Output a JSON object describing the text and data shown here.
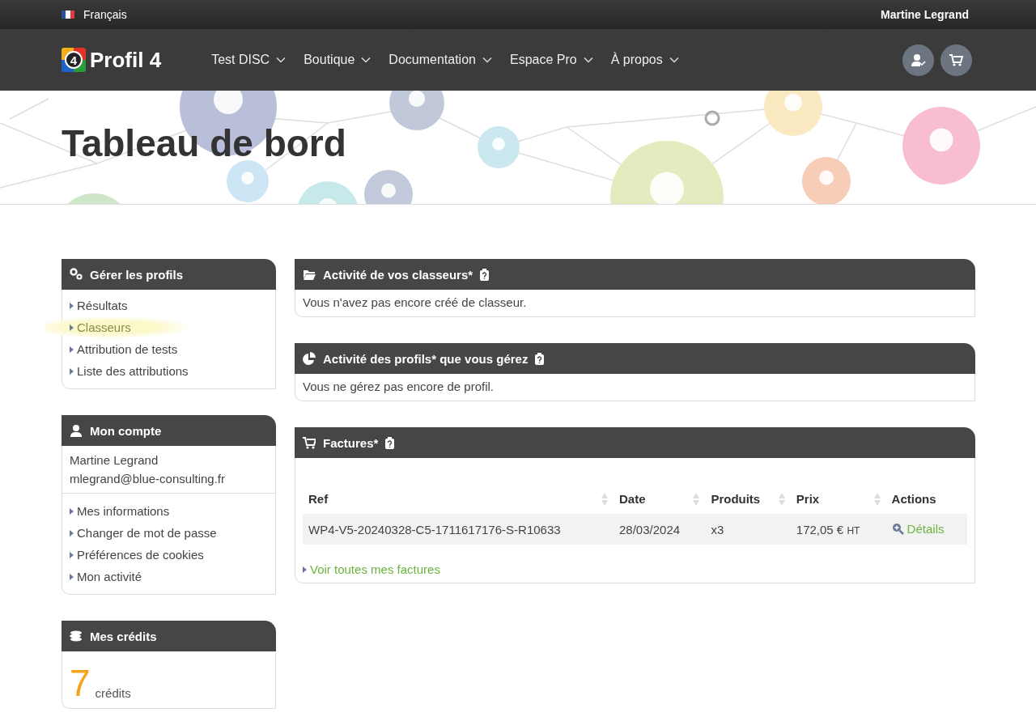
{
  "top_bar": {
    "language": "Français",
    "user": "Martine Legrand"
  },
  "nav": {
    "logo": {
      "badge": "4",
      "text": "Profil 4"
    },
    "menu": [
      {
        "label": "Test DISC"
      },
      {
        "label": "Boutique"
      },
      {
        "label": "Documentation"
      },
      {
        "label": "Espace Pro"
      },
      {
        "label": "À propos"
      }
    ],
    "actions": [
      {
        "kind": "account"
      },
      {
        "kind": "cart"
      }
    ]
  },
  "hero": {
    "title": "Tableau de bord",
    "kind": "picture"
  },
  "sidebar": [
    {
      "kind": "links",
      "title": "Gérer les profils",
      "items": [
        {
          "label": "Résultats",
          "highlighted": false
        },
        {
          "label": "Classeurs",
          "highlighted": true
        },
        {
          "label": "Attribution de tests",
          "highlighted": false
        },
        {
          "label": "Liste des attributions",
          "highlighted": false
        }
      ]
    },
    {
      "kind": "account",
      "title": "Mon compte",
      "name": "Martine Legrand",
      "email": "mlegrand@blue-consulting.fr",
      "items": [
        {
          "label": "Mes informations",
          "highlighted": false
        },
        {
          "label": "Changer de mot de passe",
          "highlighted": false
        },
        {
          "label": "Préférences de cookies",
          "highlighted": false
        },
        {
          "label": "Mon activité",
          "highlighted": false
        }
      ]
    },
    {
      "kind": "credits",
      "title": "Mes crédits",
      "amount": "7",
      "unit": "crédits"
    }
  ],
  "main": [
    {
      "kind": "message",
      "title": "Activité de vos classeurs*",
      "text": "Vous n'avez pas encore créé de classeur."
    },
    {
      "kind": "message",
      "title": "Activité des profils* que vous gérez",
      "text": "Vous ne gérez pas encore de profil."
    },
    {
      "kind": "table",
      "title": "Factures*",
      "columns": [
        {
          "label": "Ref",
          "sortable": true
        },
        {
          "label": "Date",
          "sortable": true
        },
        {
          "label": "Produits",
          "sortable": true
        },
        {
          "label": "Prix",
          "sortable": true
        },
        {
          "label": "Actions",
          "sortable": false
        }
      ],
      "rows": [
        {
          "ref": "WP4-V5-20240328-C5-1711617176-S-R10633",
          "date": "28/03/2024",
          "products": "x3",
          "price": "172,05 €",
          "price_suffix": "HT",
          "action": "Détails"
        }
      ],
      "link": "Voir toutes mes factures"
    }
  ]
}
